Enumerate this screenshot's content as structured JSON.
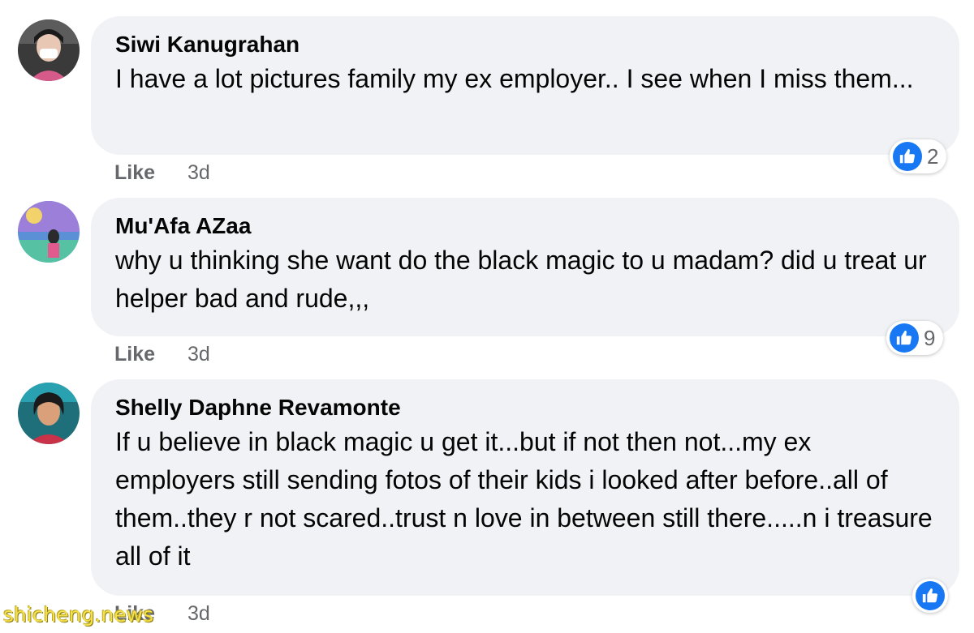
{
  "comments": [
    {
      "author": "Siwi Kanugrahan",
      "text": "I have a lot pictures family my ex employer.. I see when I miss them...",
      "like_label": "Like",
      "time": "3d",
      "reaction_count": "2"
    },
    {
      "author": "Mu'Afa AZaa",
      "text": "why u thinking she want do the black magic to u madam? did u treat ur helper bad and rude,,,",
      "like_label": "Like",
      "time": "3d",
      "reaction_count": "9"
    },
    {
      "author": "Shelly Daphne Revamonte",
      "text": "If u believe in black magic u get it...but if not then not...my ex employers still sending fotos of their kids i looked after before..all of them..they r not scared..trust n love in between still there.....n i treasure all of it",
      "like_label": "Like",
      "time": "3d",
      "reaction_count": ""
    }
  ],
  "watermark": "shicheng.news",
  "colors": {
    "bubble": "#f0f2f5",
    "like_blue": "#1877f2",
    "secondary_text": "#65676b"
  }
}
